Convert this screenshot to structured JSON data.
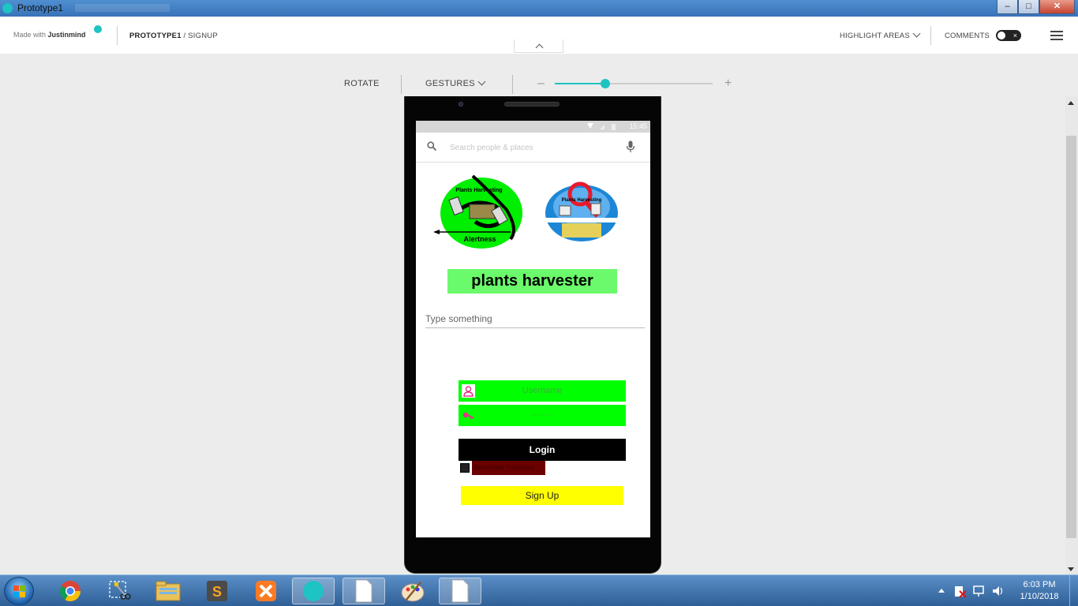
{
  "window": {
    "title": "Prototype1",
    "controls": {
      "minimize": "‒",
      "maximize": "□",
      "close": "✕"
    }
  },
  "header": {
    "made_with": "Made with",
    "brand": "Justinmind",
    "breadcrumb_project": "PROTOTYPE1",
    "breadcrumb_sep": " / ",
    "breadcrumb_page": "SIGNUP",
    "highlight_areas": "HIGHLIGHT AREAS",
    "comments": "COMMENTS",
    "comments_toggle_off_glyph": "×"
  },
  "toolbar": {
    "rotate": "ROTATE",
    "gestures": "GESTURES",
    "zoom_minus": "–",
    "zoom_plus": "+",
    "zoom_level": 0.32
  },
  "phone": {
    "status_time": "15:45",
    "search_placeholder": "Search people & places",
    "logo_left_text_top": "Plants Harvesting",
    "logo_left_text_bottom": "Alertness",
    "logo_right_text": "Plants Harvesting",
    "app_title": "plants harvester",
    "type_placeholder": "Type something",
    "username_placeholder": "Username",
    "password_placeholder": "········",
    "login_label": "Login",
    "remember_label": "Remember Password",
    "signup_label": "Sign Up"
  },
  "taskbar": {
    "apps": [
      "windows-explorer-start",
      "chrome",
      "snipping-tool",
      "file-explorer",
      "sublime-text",
      "xampp",
      "justinmind",
      "notepad-blank",
      "paint",
      "notepad-blank-2"
    ],
    "clock_time": "6:03 PM",
    "clock_date": "1/10/2018"
  },
  "colors": {
    "accent": "#1ec3c3",
    "field_green": "#00ff00",
    "title_green": "#6bfa6b",
    "signup_yellow": "#ffff00",
    "remember_dark_red": "#6b0000"
  }
}
